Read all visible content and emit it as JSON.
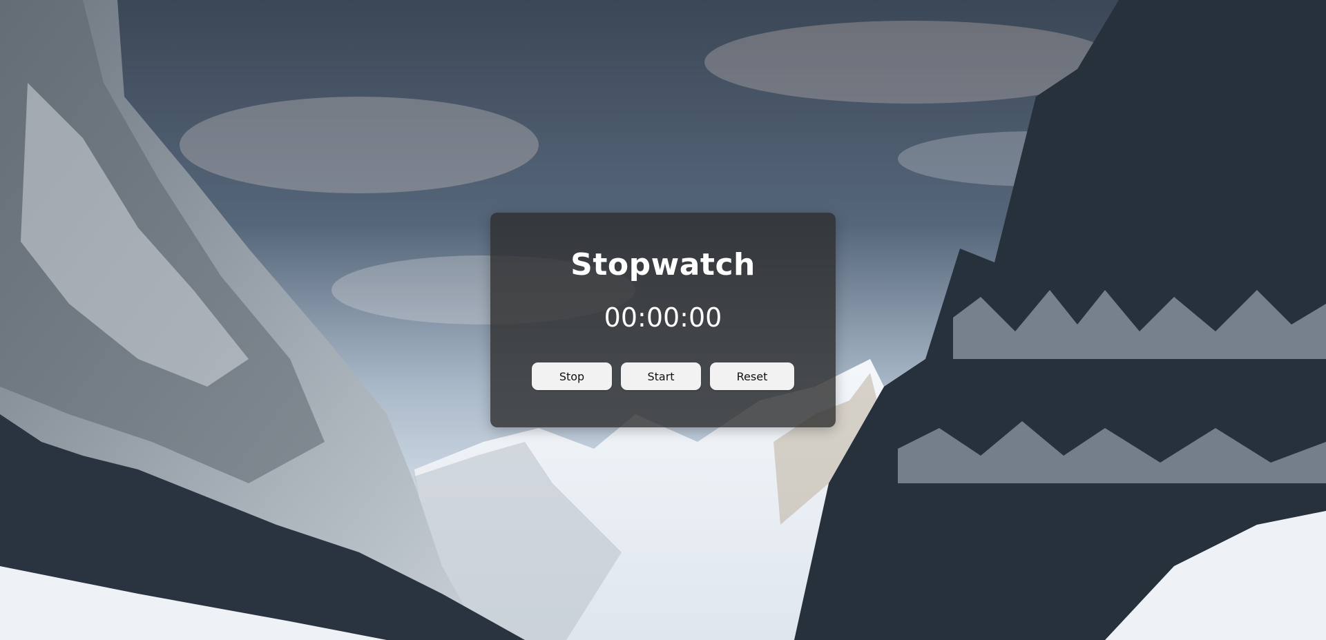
{
  "stopwatch": {
    "title": "Stopwatch",
    "time": "00:00:00",
    "buttons": {
      "stop": "Stop",
      "start": "Start",
      "reset": "Reset"
    }
  },
  "colors": {
    "card_background": "#2d2d2d",
    "button_background": "#f2f2f2",
    "text": "#ffffff"
  },
  "background": {
    "description_icon": "snowy-mountain-valley-background"
  }
}
